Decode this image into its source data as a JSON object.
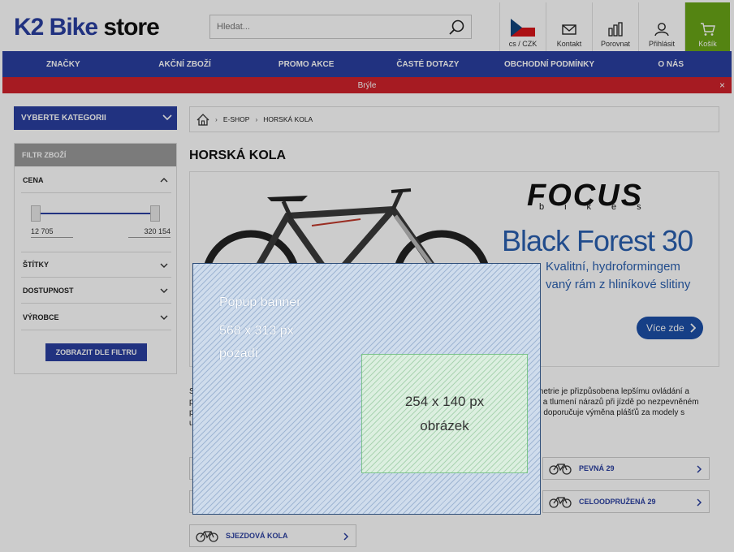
{
  "header": {
    "logo_k2": "K2 Bike",
    "logo_store": "store",
    "search_placeholder": "Hledat...",
    "icons": [
      {
        "label": "cs / CZK",
        "icon": "czech-flag-icon"
      },
      {
        "label": "Kontakt",
        "icon": "contact-icon"
      },
      {
        "label": "Porovnat",
        "icon": "compare-icon"
      },
      {
        "label": "Přihlásit",
        "icon": "user-icon"
      },
      {
        "label": "Košík",
        "icon": "cart-icon"
      }
    ],
    "cart_color": "#6aa517"
  },
  "nav": {
    "items": [
      "ZNAČKY",
      "AKČNÍ ZBOŽÍ",
      "PROMO AKCE",
      "ČASTÉ DOTAZY",
      "OBCHODNÍ PODMÍNKY",
      "O NÁS"
    ],
    "color": "#2a3fa0"
  },
  "promo": {
    "text": "Brýle",
    "close": "×",
    "color": "#d0222b"
  },
  "sidebar": {
    "category_button": "VYBERTE KATEGORII",
    "filter_title": "FILTR ZBOŽÍ",
    "price_label": "CENA",
    "price_min": "12 705",
    "price_max": "320 154",
    "filters": [
      "ŠTÍTKY",
      "DOSTUPNOST",
      "VÝROBCE"
    ],
    "apply_button": "ZOBRAZIT DLE FILTRU"
  },
  "breadcrumb": {
    "home_icon": "home-icon",
    "items": [
      "E-SHOP",
      "HORSKÁ KOLA"
    ]
  },
  "page": {
    "title": "HORSKÁ KOLA"
  },
  "banner": {
    "brand": "FOCUS",
    "brand_sub": "bikes",
    "model": "Black Forest 30",
    "desc_line1": "Kvalitní, hydroformingem",
    "desc_line2": "vaný rám z hliníkové slitiny",
    "button": "Více zde"
  },
  "text": {
    "lines": [
      "metrie je přizpůsobena lepšímu ovládání a",
      "y a tlumení nárazů při jízdě po nezpevněném",
      "e doporučuje výměna plášťů za modely s"
    ],
    "left_chars": [
      "S",
      "p",
      "p",
      "u"
    ]
  },
  "categories": [
    {
      "label": "PEVNÁ 29"
    },
    {
      "label": "CELOODPRUŽENÁ 29"
    },
    {
      "label": "SJEZDOVÁ KOLA"
    }
  ],
  "popup": {
    "line1": "Popup banner",
    "line2": "568 x 313 px",
    "line3": "pozadí",
    "image_line1": "254 x 140 px",
    "image_line2": "obrázek"
  }
}
